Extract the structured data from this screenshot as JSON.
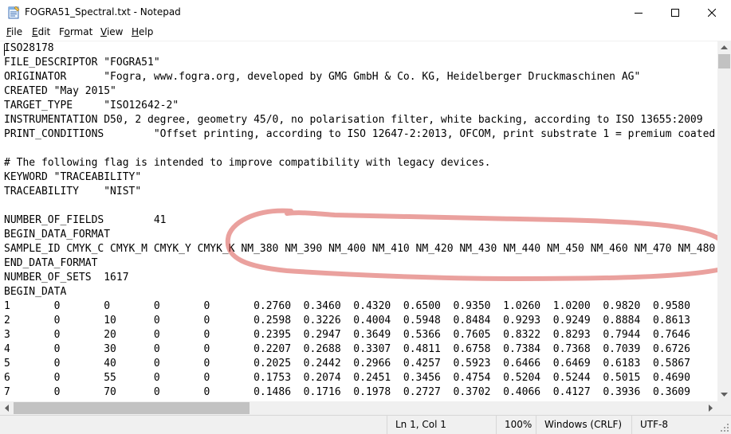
{
  "window": {
    "title": "FOGRA51_Spectral.txt - Notepad",
    "icon": "notepad-icon"
  },
  "menu": [
    {
      "label": "File",
      "access_key": "F",
      "rest": "ile"
    },
    {
      "label": "Edit",
      "access_key": "E",
      "rest": "dit"
    },
    {
      "label": "Format",
      "access_key": "o",
      "pre": "F",
      "rest": "rmat"
    },
    {
      "label": "View",
      "access_key": "V",
      "rest": "iew"
    },
    {
      "label": "Help",
      "access_key": "H",
      "rest": "elp"
    }
  ],
  "document": {
    "lines": [
      "ISO28178",
      "FILE_DESCRIPTOR \"FOGRA51\"",
      "ORIGINATOR      \"Fogra, www.fogra.org, developed by GMG GmbH & Co. KG, Heidelberger Druckmaschinen AG\"",
      "CREATED \"May 2015\"",
      "TARGET_TYPE     \"ISO12642-2\"",
      "INSTRUMENTATION D50, 2 degree, geometry 45/0, no polarisation filter, white backing, according to ISO 13655:2009",
      "PRINT_CONDITIONS        \"Offset printing, according to ISO 12647-2:2013, OFCOM, print substrate 1 = premium coated",
      "",
      "# The following flag is intended to improve compatibility with legacy devices.",
      "KEYWORD \"TRACEABILITY\"",
      "TRACEABILITY    \"NIST\"",
      "",
      "NUMBER_OF_FIELDS        41",
      "BEGIN_DATA_FORMAT",
      "SAMPLE_ID CMYK_C CMYK_M CMYK_Y CMYK_K NM_380 NM_390 NM_400 NM_410 NM_420 NM_430 NM_440 NM_450 NM_460 NM_470 NM_480",
      "END_DATA_FORMAT",
      "NUMBER_OF_SETS  1617",
      "BEGIN_DATA",
      "1       0       0       0       0       0.2760  0.3460  0.4320  0.6500  0.9350  1.0260  1.0200  0.9820  0.9580",
      "2       0       10      0       0       0.2598  0.3226  0.4004  0.5948  0.8484  0.9293  0.9249  0.8884  0.8613",
      "3       0       20      0       0       0.2395  0.2947  0.3649  0.5366  0.7605  0.8322  0.8293  0.7944  0.7646",
      "4       0       30      0       0       0.2207  0.2688  0.3307  0.4811  0.6758  0.7384  0.7368  0.7039  0.6726",
      "5       0       40      0       0       0.2025  0.2442  0.2966  0.4257  0.5923  0.6466  0.6469  0.6183  0.5867",
      "6       0       55      0       0       0.1753  0.2074  0.2451  0.3456  0.4754  0.5204  0.5244  0.5015  0.4690",
      "7       0       70      0       0       0.1486  0.1716  0.1978  0.2727  0.3702  0.4066  0.4127  0.3936  0.3609"
    ]
  },
  "status": {
    "position": "Ln 1, Col 1",
    "zoom": "100%",
    "line_endings": "Windows (CRLF)",
    "encoding": "UTF-8"
  },
  "annotation": {
    "color": "#d9534f",
    "shape": "hand-drawn-ellipse"
  }
}
